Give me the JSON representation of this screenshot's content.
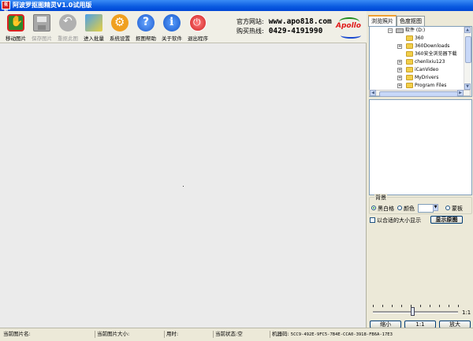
{
  "window": {
    "title": "阿波罗抠图精灵V1.0试用版",
    "icon_label": "抠图"
  },
  "toolbar": {
    "buttons": [
      {
        "label": "移动图片",
        "icon": "hand-icon",
        "enabled": true
      },
      {
        "label": "保存图片",
        "icon": "floppy-icon",
        "enabled": false
      },
      {
        "label": "重抠此图",
        "icon": "reset-icon",
        "enabled": false
      },
      {
        "label": "进入批量",
        "icon": "batch-icon",
        "enabled": true
      },
      {
        "label": "系统设置",
        "icon": "gear-icon",
        "enabled": true
      },
      {
        "label": "抠图帮助",
        "icon": "help-icon",
        "enabled": true
      },
      {
        "label": "关于软件",
        "icon": "info-icon",
        "enabled": true
      },
      {
        "label": "退出程序",
        "icon": "power-icon",
        "enabled": true
      }
    ]
  },
  "header": {
    "site_label": "官方网站:",
    "site_url": "www.apo818.com",
    "phone_label": "购买热线:",
    "phone": "0429-4191990",
    "logo_text": "Apollo"
  },
  "right_panel": {
    "tabs": [
      {
        "label": "浏览照片",
        "active": true
      },
      {
        "label": "色度抠图",
        "active": false
      }
    ],
    "tree": {
      "root": "软件 (D:)",
      "folders": [
        "360",
        "360Downloads",
        "360安全浏览器下载",
        "chenlixiu123",
        "iCanVideo",
        "MyDrivers",
        "Program Files"
      ]
    },
    "background": {
      "legend": "背景",
      "options": [
        {
          "label": "黑白格",
          "selected": true
        },
        {
          "label": "颜色",
          "selected": false
        },
        {
          "label": "蒙板",
          "selected": false
        }
      ]
    },
    "fit_checkbox": {
      "label": "以合适的大小显示",
      "checked": false
    },
    "show_original_button": "显示原图",
    "zoom": {
      "max_label": "1:1",
      "buttons": {
        "zoom_out": "缩小",
        "actual": "1:1",
        "zoom_in": "放大"
      }
    }
  },
  "statusbar": {
    "current_image": "当前图片名:",
    "image_size": "当前图片大小:",
    "time": "用时:",
    "state_label": "当前状态:",
    "state_value": "空",
    "machine_label": "机器码:",
    "machine_code": "5CC9-492E-9FC5-7B4E-CCA0-3918-FB6A-17E3"
  },
  "colors": {
    "titlebar": "#0a5ae0",
    "accent_tab": "#f0a030",
    "logo_red": "#e01818"
  }
}
